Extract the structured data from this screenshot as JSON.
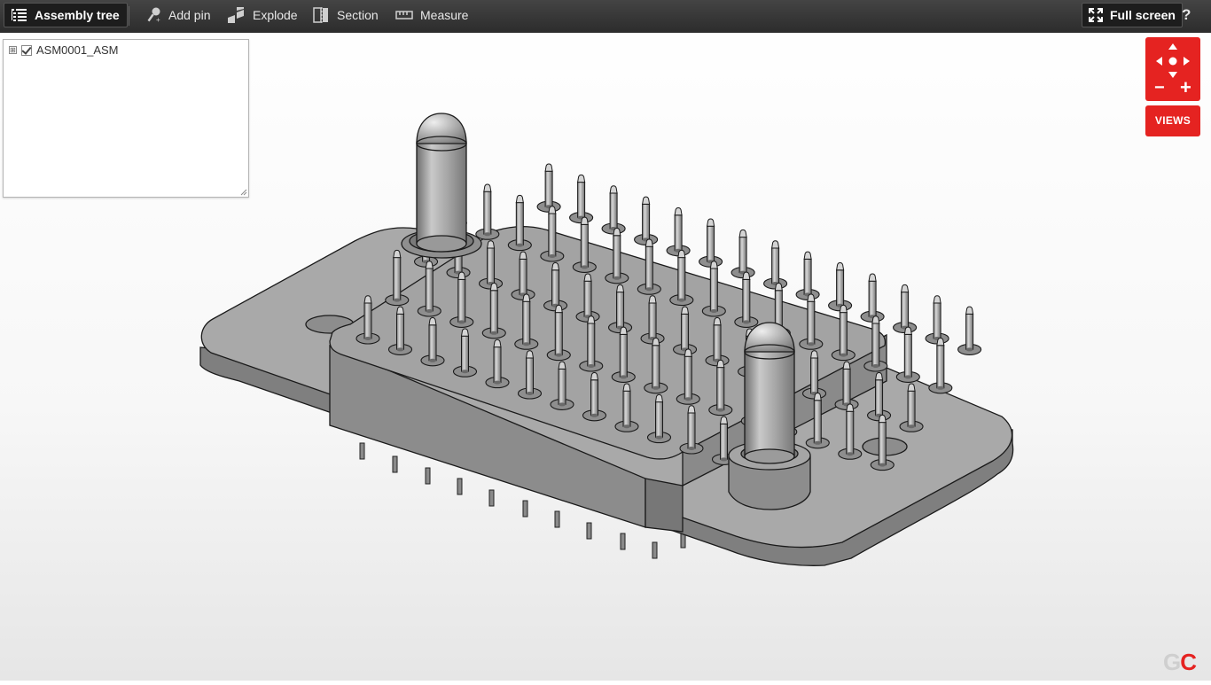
{
  "toolbar": {
    "assembly_tree_label": "Assembly tree",
    "add_pin_label": "Add pin",
    "explode_label": "Explode",
    "section_label": "Section",
    "measure_label": "Measure",
    "full_screen_label": "Full screen",
    "help_label": "?"
  },
  "tree": {
    "items": [
      {
        "label": "ASM0001_ASM",
        "checked": true,
        "expander": "⊞"
      }
    ]
  },
  "nav": {
    "zoom_out_label": "−",
    "zoom_in_label": "+",
    "views_label": "VIEWS"
  },
  "logo": {
    "part1": "G",
    "part2": "C"
  },
  "colors": {
    "accent": "#e52321",
    "toolbar": "#333333",
    "model": "#9a9a9a"
  }
}
